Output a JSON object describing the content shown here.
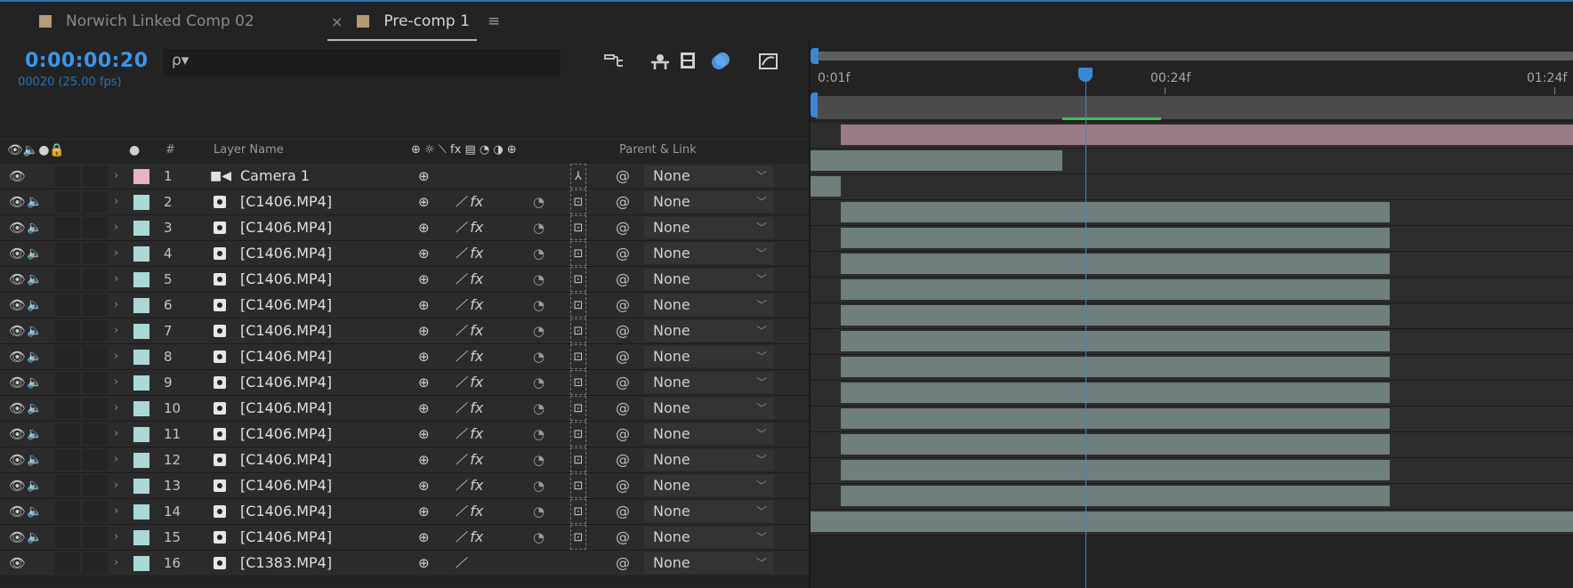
{
  "tabs": [
    {
      "label": "Norwich Linked Comp 02",
      "active": false,
      "swatch": "#b49a76"
    },
    {
      "label": "Pre-comp 1",
      "active": true,
      "swatch": "#b49a76"
    }
  ],
  "tab_icons": {
    "close": "×",
    "menu": "≡"
  },
  "timecode": "0:00:00:20",
  "frame_info": "00020 (25.00 fps)",
  "search": {
    "placeholder": "",
    "glyph": "ρ▾"
  },
  "toolbar_icons": [
    "comp-flowchart-icon",
    "shy-layers-icon",
    "frame-blending-icon",
    "motion-blur-icon",
    "graph-editor-icon"
  ],
  "columns": {
    "av": "👁🔈●🔒",
    "label": "●",
    "number": "#",
    "layer_name": "Layer Name",
    "switches": "⊕ ☼ ⟍ fx ▤ ◔ ◑ ⊕",
    "parent": "Parent & Link"
  },
  "layers": [
    {
      "num": "1",
      "name": "Camera 1",
      "type": "camera",
      "color": "#e8b4c2",
      "audio": false,
      "fx": false
    },
    {
      "num": "2",
      "name": "[C1406.MP4]",
      "type": "footage",
      "color": "#a9d8d6",
      "audio": true,
      "fx": true
    },
    {
      "num": "3",
      "name": "[C1406.MP4]",
      "type": "footage",
      "color": "#a9d8d6",
      "audio": true,
      "fx": true
    },
    {
      "num": "4",
      "name": "[C1406.MP4]",
      "type": "footage",
      "color": "#a9d8d6",
      "audio": true,
      "fx": true
    },
    {
      "num": "5",
      "name": "[C1406.MP4]",
      "type": "footage",
      "color": "#a9d8d6",
      "audio": true,
      "fx": true
    },
    {
      "num": "6",
      "name": "[C1406.MP4]",
      "type": "footage",
      "color": "#a9d8d6",
      "audio": true,
      "fx": true
    },
    {
      "num": "7",
      "name": "[C1406.MP4]",
      "type": "footage",
      "color": "#a9d8d6",
      "audio": true,
      "fx": true
    },
    {
      "num": "8",
      "name": "[C1406.MP4]",
      "type": "footage",
      "color": "#a9d8d6",
      "audio": true,
      "fx": true
    },
    {
      "num": "9",
      "name": "[C1406.MP4]",
      "type": "footage",
      "color": "#a9d8d6",
      "audio": true,
      "fx": true
    },
    {
      "num": "10",
      "name": "[C1406.MP4]",
      "type": "footage",
      "color": "#a9d8d6",
      "audio": true,
      "fx": true
    },
    {
      "num": "11",
      "name": "[C1406.MP4]",
      "type": "footage",
      "color": "#a9d8d6",
      "audio": true,
      "fx": true
    },
    {
      "num": "12",
      "name": "[C1406.MP4]",
      "type": "footage",
      "color": "#a9d8d6",
      "audio": true,
      "fx": true
    },
    {
      "num": "13",
      "name": "[C1406.MP4]",
      "type": "footage",
      "color": "#a9d8d6",
      "audio": true,
      "fx": true
    },
    {
      "num": "14",
      "name": "[C1406.MP4]",
      "type": "footage",
      "color": "#a9d8d6",
      "audio": true,
      "fx": true
    },
    {
      "num": "15",
      "name": "[C1406.MP4]",
      "type": "footage",
      "color": "#a9d8d6",
      "audio": true,
      "fx": true
    },
    {
      "num": "16",
      "name": "[C1383.MP4]",
      "type": "footage",
      "color": "#a9d8d6",
      "audio": false,
      "fx": false
    }
  ],
  "parent_value": "None",
  "ruler": {
    "labels": [
      "0:01f",
      "00:24f",
      "01:24f"
    ]
  },
  "timeline_bars": [
    {
      "start": 0.04,
      "end": 1.0,
      "color": "#9a7a85"
    },
    {
      "start": 0.0,
      "end": 0.33,
      "color": "#6e7f7d"
    },
    {
      "start": 0.0,
      "end": 0.04,
      "color": "#6e7f7d"
    },
    {
      "start": 0.04,
      "end": 0.76,
      "color": "#6e7f7d"
    },
    {
      "start": 0.04,
      "end": 0.76,
      "color": "#6e7f7d"
    },
    {
      "start": 0.04,
      "end": 0.76,
      "color": "#6e7f7d"
    },
    {
      "start": 0.04,
      "end": 0.76,
      "color": "#6e7f7d"
    },
    {
      "start": 0.04,
      "end": 0.76,
      "color": "#6e7f7d"
    },
    {
      "start": 0.04,
      "end": 0.76,
      "color": "#6e7f7d"
    },
    {
      "start": 0.04,
      "end": 0.76,
      "color": "#6e7f7d"
    },
    {
      "start": 0.04,
      "end": 0.76,
      "color": "#6e7f7d"
    },
    {
      "start": 0.04,
      "end": 0.76,
      "color": "#6e7f7d"
    },
    {
      "start": 0.04,
      "end": 0.76,
      "color": "#6e7f7d"
    },
    {
      "start": 0.04,
      "end": 0.76,
      "color": "#6e7f7d"
    },
    {
      "start": 0.04,
      "end": 0.76,
      "color": "#6e7f7d"
    },
    {
      "start": 0.0,
      "end": 1.0,
      "color": "#6e7f7d"
    }
  ],
  "playhead": 0.36,
  "work_area": {
    "start": 0.33,
    "end": 0.46
  },
  "colors": {
    "accent": "#3c86d6",
    "work_area_marker": "#2bd14c"
  }
}
